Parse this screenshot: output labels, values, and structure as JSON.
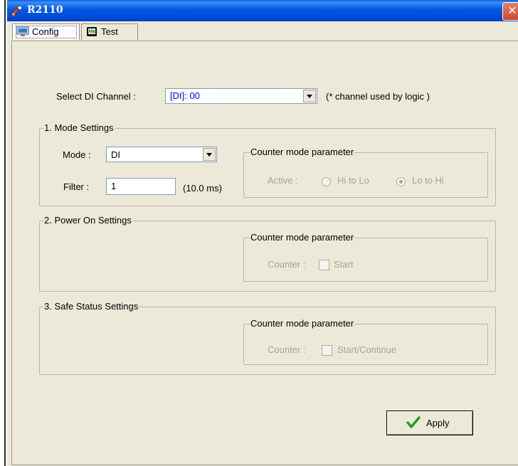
{
  "window": {
    "title": "R2110",
    "close_glyph": "✕"
  },
  "tabs": [
    {
      "label": "Config",
      "active": true
    },
    {
      "label": "Test",
      "active": false
    }
  ],
  "channel": {
    "label": "Select DI Channel :",
    "value": "[DI]: 00",
    "note": "(* channel used by logic )",
    "value_color": "#0000ff"
  },
  "mode_settings": {
    "title": "1. Mode Settings",
    "mode_label": "Mode :",
    "mode_value": "DI",
    "filter_label": "Filter :",
    "filter_value": "1",
    "filter_unit": "(10.0 ms)",
    "counter_group_title": "Counter mode parameter",
    "active_label": "Active :",
    "option_hi_lo": "Hi to Lo",
    "option_lo_hi": "Lo to Hi",
    "selected": "Lo to Hi"
  },
  "power_on": {
    "title": "2. Power On Settings",
    "counter_group_title": "Counter mode parameter",
    "counter_label": "Counter :",
    "checkbox_label": "Start",
    "checked": false
  },
  "safe_status": {
    "title": "3. Safe Status Settings",
    "counter_group_title": "Counter mode parameter",
    "counter_label": "Counter :",
    "checkbox_label": "Start/Continue",
    "checked": false
  },
  "apply_label": "Apply",
  "colors": {
    "titlebar": "#0058e6",
    "panel_bg": "#ece9d8",
    "disabled_text": "#a6a393",
    "check_green": "#1e9e1e"
  },
  "icons": [
    "app-icon",
    "monitor-icon",
    "chip-icon",
    "checkmark-icon",
    "close-icon",
    "chevron-down-icon"
  ]
}
